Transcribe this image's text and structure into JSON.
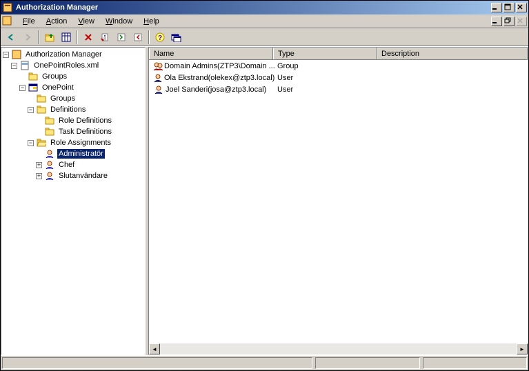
{
  "window": {
    "title": "Authorization Manager"
  },
  "menus": {
    "file": "File",
    "action": "Action",
    "view": "View",
    "window": "Window",
    "help": "Help"
  },
  "tree": {
    "root": "Authorization Manager",
    "file": "OnePointRoles.xml",
    "groups": "Groups",
    "app": "OnePoint",
    "appGroups": "Groups",
    "definitions": "Definitions",
    "roleDefs": "Role Definitions",
    "taskDefs": "Task Definitions",
    "roleAssign": "Role Assignments",
    "admin": "Administratör",
    "chef": "Chef",
    "slutanv": "Slutanvändare"
  },
  "columns": {
    "name": "Name",
    "type": "Type",
    "description": "Description"
  },
  "rows": [
    {
      "name": "Domain Admins(ZTP3\\Domain ...",
      "type": "Group",
      "iconType": "group"
    },
    {
      "name": "Ola Ekstrand(olekex@ztp3.local)",
      "type": "User",
      "iconType": "user"
    },
    {
      "name": "Joel Sanderi(josa@ztp3.local)",
      "type": "User",
      "iconType": "user"
    }
  ]
}
